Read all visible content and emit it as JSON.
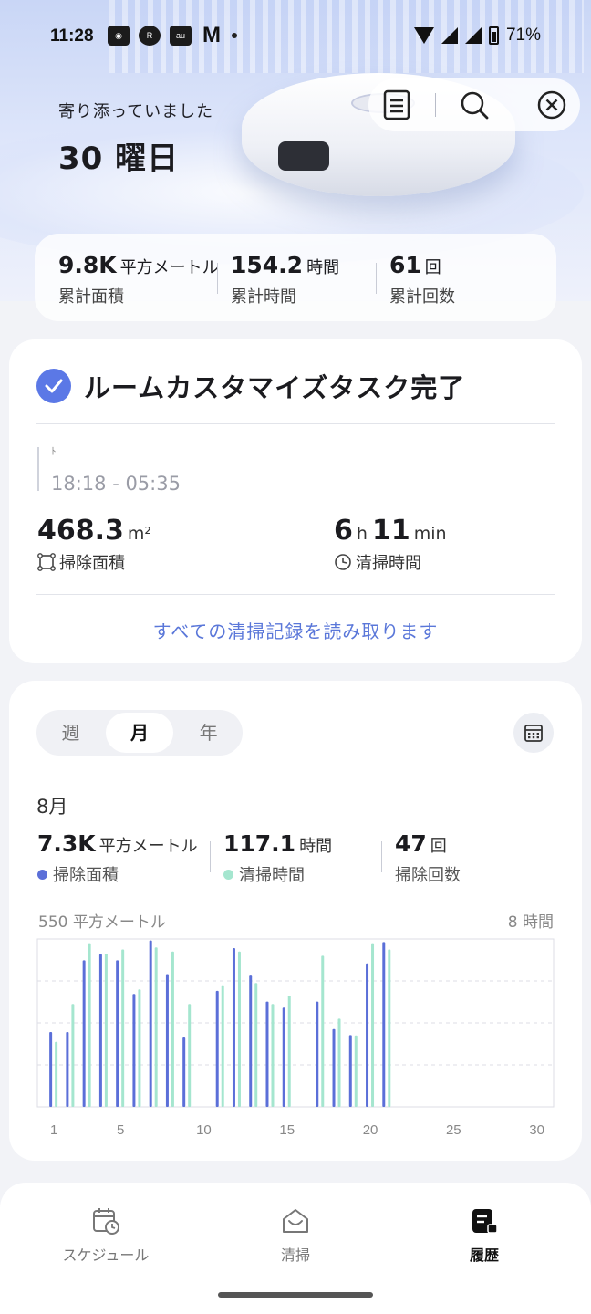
{
  "status_bar": {
    "time": "11:28",
    "icons": [
      "message-icon",
      "rakuten-link-icon",
      "au-pay-icon",
      "mcdonalds-icon",
      "notification-dot"
    ],
    "battery": "71%"
  },
  "hero": {
    "subtitle": "寄り添っていました",
    "days": "30 曜日",
    "actions": [
      "document-icon",
      "search-icon",
      "close-icon"
    ]
  },
  "totals": [
    {
      "value": "9.8K",
      "unit": "平方メートル",
      "label": "累計面積"
    },
    {
      "value": "154.2",
      "unit": "時間",
      "label": "累計時間"
    },
    {
      "value": "61",
      "unit": "回",
      "label": "累計回数"
    }
  ],
  "task": {
    "title": "ルームカスタマイズタスク完了",
    "tag": "ﾄ",
    "time_range": "18:18 - 05:35",
    "area": {
      "value": "468.3",
      "unit": "m²",
      "label": "掃除面積"
    },
    "duration": {
      "hours": "6",
      "h_unit": "h",
      "minutes": "11",
      "m_unit": "min",
      "label": "清掃時間"
    },
    "link": "すべての清掃記録を読み取ります"
  },
  "stats": {
    "tabs": [
      "週",
      "月",
      "年"
    ],
    "active_tab": "月",
    "month": "8月",
    "area": {
      "value": "7.3K",
      "unit": "平方メートル",
      "label": "掃除面積"
    },
    "time": {
      "value": "117.1",
      "unit": "時間",
      "label": "清掃時間"
    },
    "count": {
      "value": "47",
      "unit": "回",
      "label": "掃除回数"
    },
    "axis_left": "550 平方メートル",
    "axis_right": "8 時間"
  },
  "colors": {
    "area_series": "#5b6fd8",
    "time_series": "#a5e6cf",
    "accent": "#5a77d9"
  },
  "chart_data": {
    "type": "bar",
    "x": [
      1,
      2,
      3,
      4,
      5,
      6,
      7,
      8,
      9,
      10,
      11,
      12,
      13,
      14,
      15,
      16,
      17,
      18,
      19,
      20,
      21,
      22,
      23,
      24,
      25,
      26,
      27,
      28,
      29,
      30,
      31
    ],
    "x_ticks": [
      1,
      5,
      10,
      15,
      20,
      25,
      30
    ],
    "series": [
      {
        "name": "掃除面積",
        "axis": "left",
        "unit": "平方メートル",
        "ylim": [
          0,
          550
        ],
        "values": [
          245,
          245,
          480,
          500,
          480,
          370,
          545,
          435,
          230,
          0,
          380,
          520,
          430,
          345,
          325,
          0,
          345,
          255,
          235,
          470,
          540,
          0,
          0,
          0,
          0,
          0,
          0,
          0,
          0,
          0,
          0
        ]
      },
      {
        "name": "清掃時間",
        "axis": "right",
        "unit": "時間",
        "ylim": [
          0,
          8
        ],
        "values": [
          3.1,
          4.9,
          7.8,
          7.3,
          7.5,
          5.6,
          7.6,
          7.4,
          4.9,
          0,
          5.8,
          7.4,
          5.9,
          4.9,
          5.3,
          0,
          7.2,
          4.2,
          3.4,
          7.8,
          7.5,
          0,
          0,
          0,
          0,
          0,
          0,
          0,
          0,
          0,
          0
        ]
      }
    ],
    "grid": true
  },
  "nav": [
    {
      "label": "スケジュール",
      "icon": "calendar-clock-icon",
      "active": false
    },
    {
      "label": "清掃",
      "icon": "robot-home-icon",
      "active": false
    },
    {
      "label": "履歴",
      "icon": "history-doc-icon",
      "active": true
    }
  ]
}
